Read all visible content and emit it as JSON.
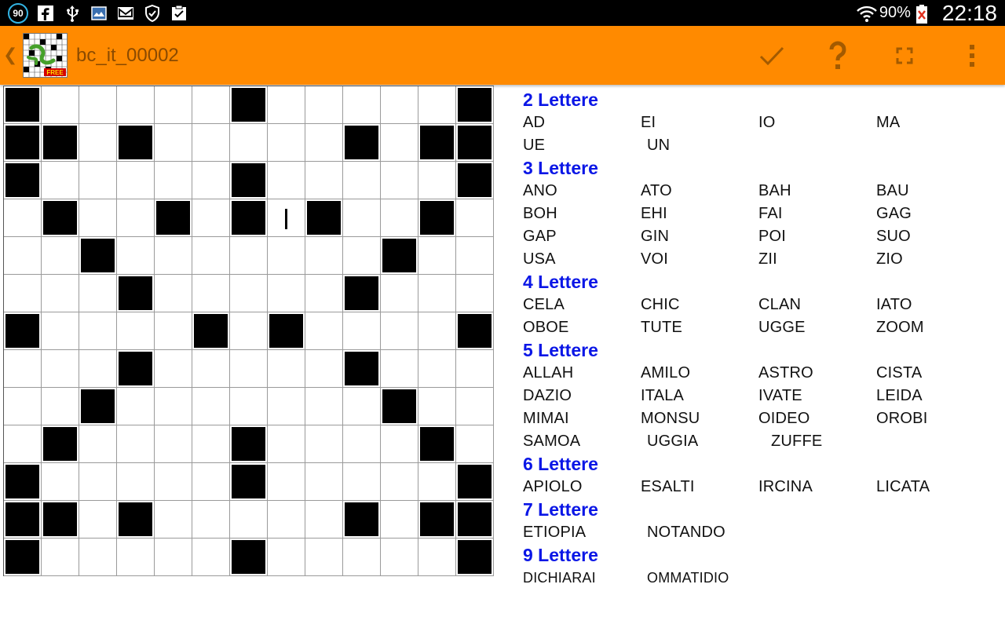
{
  "status_bar": {
    "notification_count": "90",
    "battery_percent": "90%",
    "time": "22:18",
    "icons": [
      "notification-count-icon",
      "facebook-icon",
      "usb-icon",
      "map-app-icon",
      "mail-icon",
      "shield-icon",
      "clipboard-check-icon",
      "wifi-icon",
      "battery-icon"
    ]
  },
  "action_bar": {
    "title": "bc_it_00002",
    "logo_badge": "FREE",
    "actions": [
      "check-icon",
      "help-icon",
      "fullscreen-icon",
      "overflow-menu-icon"
    ],
    "accent_color": "#ff8a00"
  },
  "grid": {
    "rows": 13,
    "cols": 13,
    "pattern": [
      "#.....#.....#",
      "##.#.....#.##",
      "#.....#.....#",
      ".#..#.#.#..#.",
      "..#.......#..",
      "...#.....#...",
      "#....#.#....#",
      "...#.....#...",
      "..#.......#..",
      ".#....#....#.",
      "#.....#.....#",
      "##.#.....#.##",
      "#.....#.....#"
    ],
    "cursor": {
      "row": 3,
      "col": 7
    }
  },
  "word_groups": [
    {
      "heading": "2 Lettere",
      "words": [
        "AD",
        "EI",
        "IO",
        "MA",
        "UE",
        "UN"
      ]
    },
    {
      "heading": "3 Lettere",
      "words": [
        "ANO",
        "ATO",
        "BAH",
        "BAU",
        "BOH",
        "EHI",
        "FAI",
        "GAG",
        "GAP",
        "GIN",
        "POI",
        "SUO",
        "USA",
        "VOI",
        "ZII",
        "ZIO"
      ]
    },
    {
      "heading": "4 Lettere",
      "words": [
        "CELA",
        "CHIC",
        "CLAN",
        "IATO",
        "OBOE",
        "TUTE",
        "UGGE",
        "ZOOM"
      ]
    },
    {
      "heading": "5 Lettere",
      "words": [
        "ALLAH",
        "AMILO",
        "ASTRO",
        "CISTA",
        "DAZIO",
        "ITALA",
        "IVATE",
        "LEIDA",
        "MIMAI",
        "MONSU",
        "OIDEO",
        "OROBI",
        "SAMOA",
        "UGGIA",
        "ZUFFE"
      ]
    },
    {
      "heading": "6 Lettere",
      "words": [
        "APIOLO",
        "ESALTI",
        "IRCINA",
        "LICATA"
      ]
    },
    {
      "heading": "7 Lettere",
      "words": [
        "ETIOPIA",
        "NOTANDO"
      ]
    },
    {
      "heading": "9 Lettere",
      "words": [
        "DICHIARAI",
        "OMMATIDIO"
      ]
    }
  ]
}
